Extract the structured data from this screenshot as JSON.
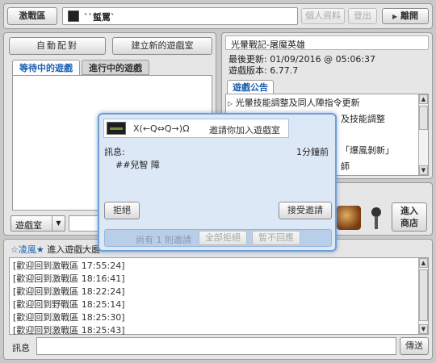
{
  "topbar": {
    "tab_label": "激戰區",
    "player_name": "``蜇罵`",
    "profile_btn": "個人資料",
    "logout_btn": "登出",
    "leave_btn": "離開"
  },
  "lobby": {
    "auto_match_btn": "自動配對",
    "create_room_btn": "建立新的遊戲室",
    "tabs": [
      "等待中的遊戲",
      "進行中的遊戲"
    ],
    "room_select_label": "遊戲室"
  },
  "game_info": {
    "title": "光暈戰記-屠魔英雄",
    "last_update_label": "最後更新:",
    "last_update_value": "01/09/2016 @ 05:06:37",
    "version_label": "遊戲版本:",
    "version_value": "6.77.7",
    "notice_tab": "遊戲公告",
    "notices": [
      "光暈技能調整及同人陣指令更新",
      "及技能調整",
      "「爆風剝新」",
      "師"
    ]
  },
  "shop": {
    "enter_shop_label_line1": "進入",
    "enter_shop_label_line2": "商店"
  },
  "chat": {
    "channel_user": "☆凌風★",
    "channel_text": "進入遊戲大廳",
    "log": [
      "[歡迎回到激戰區 17:55:24]",
      "[歡迎回到激戰區 18:16:41]",
      "[歡迎回到激戰區 18:22:24]",
      "[歡迎回到野戰區 18:25:14]",
      "[歡迎回到激戰區 18:25:30]",
      "[歡迎回到激戰區 18:25:43]"
    ],
    "input_label": "訊息",
    "send_btn": "傳送"
  },
  "invite_dialog": {
    "inviter": "X(←Q⇔Q→)Ω",
    "invite_text": "邀請你加入遊戲室",
    "message_label": "訊息:",
    "time_ago": "1分鐘前",
    "message_body": "##兒智 障",
    "reject_btn": "拒絕",
    "accept_btn": "接受邀請",
    "pending_text": "尚有 1 則邀請",
    "reject_all_btn": "全部拒絕",
    "ignore_btn": "暫不回應"
  },
  "colors": {
    "accent_blue": "#1a5fb4",
    "dialog_border": "#6f9fd8",
    "dialog_bg": "#dde8f6"
  }
}
